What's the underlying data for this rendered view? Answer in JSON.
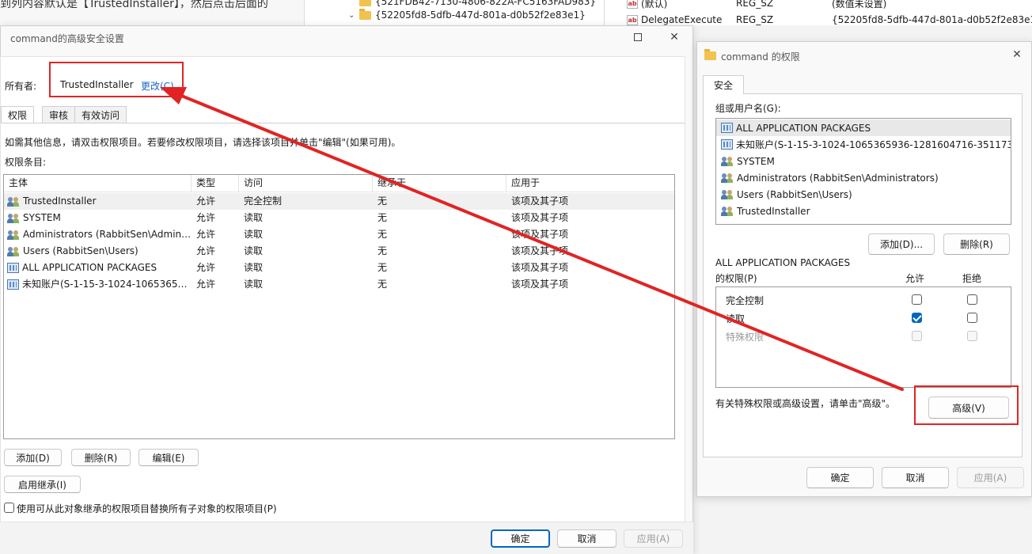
{
  "background": {
    "doc_text": "到列内容默认是【TrustedInstaller】，然后点击后面的",
    "tree_items": [
      "{521FDB42-7130-4806-822A-FC5163FAD983}",
      "{52205fd8-5dfb-447d-801a-d0b52f2e83e1}"
    ],
    "registry_rows": [
      {
        "name": "(默认)",
        "type": "REG_SZ",
        "data": "(数值未设置)"
      },
      {
        "name": "DelegateExecute",
        "type": "REG_SZ",
        "data": "{52205fd8-5dfb-447d-801a-d0b52f2e83e1}"
      }
    ]
  },
  "left_dialog": {
    "title": "command的高级安全设置",
    "owner_label": "所有者:",
    "owner_value": "TrustedInstaller",
    "change_link": "更改(C)",
    "tabs": [
      "权限",
      "审核",
      "有效访问"
    ],
    "info_text": "如需其他信息，请双击权限项目。若要修改权限项目，请选择该项目并单击\"编辑\"(如果可用)。",
    "entries_label": "权限条目:",
    "columns": [
      "主体",
      "类型",
      "访问",
      "继承于",
      "应用于"
    ],
    "rows": [
      {
        "principal": "TrustedInstaller",
        "type": "允许",
        "access": "完全控制",
        "inherited": "无",
        "applies": "该项及其子项",
        "icon": "users-icon"
      },
      {
        "principal": "SYSTEM",
        "type": "允许",
        "access": "读取",
        "inherited": "无",
        "applies": "该项及其子项",
        "icon": "users-icon"
      },
      {
        "principal": "Administrators (RabbitSen\\Adminis...",
        "type": "允许",
        "access": "读取",
        "inherited": "无",
        "applies": "该项及其子项",
        "icon": "users-icon"
      },
      {
        "principal": "Users (RabbitSen\\Users)",
        "type": "允许",
        "access": "读取",
        "inherited": "无",
        "applies": "该项及其子项",
        "icon": "users-icon"
      },
      {
        "principal": "ALL APPLICATION PACKAGES",
        "type": "允许",
        "access": "读取",
        "inherited": "无",
        "applies": "该项及其子项",
        "icon": "package-icon"
      },
      {
        "principal": "未知账户(S-1-15-3-1024-106536593...",
        "type": "允许",
        "access": "读取",
        "inherited": "无",
        "applies": "该项及其子项",
        "icon": "package-icon"
      }
    ],
    "add_btn": "添加(D)",
    "remove_btn": "删除(R)",
    "edit_btn": "编辑(E)",
    "enable_inherit_btn": "启用继承(I)",
    "replace_checkbox_label": "使用可从此对象继承的权限项目替换所有子对象的权限项目(P)",
    "ok_btn": "确定",
    "cancel_btn": "取消",
    "apply_btn": "应用(A)"
  },
  "right_dialog": {
    "title": "command 的权限",
    "tab": "安全",
    "group_label": "组或用户名(G):",
    "groups": [
      {
        "name": "ALL APPLICATION PACKAGES",
        "icon": "package-icon"
      },
      {
        "name": "未知账户(S-1-15-3-1024-1065365936-1281604716-351173...",
        "icon": "package-icon"
      },
      {
        "name": "SYSTEM",
        "icon": "users-icon"
      },
      {
        "name": "Administrators (RabbitSen\\Administrators)",
        "icon": "users-icon"
      },
      {
        "name": "Users (RabbitSen\\Users)",
        "icon": "users-icon"
      },
      {
        "name": "TrustedInstaller",
        "icon": "users-icon"
      }
    ],
    "add_btn": "添加(D)...",
    "remove_btn": "删除(R)",
    "perm_for": "ALL APPLICATION PACKAGES",
    "perm_label": "的权限(P)",
    "allow_header": "允许",
    "deny_header": "拒绝",
    "permissions": [
      {
        "name": "完全控制",
        "allow": false,
        "deny": false,
        "enabled": true
      },
      {
        "name": "读取",
        "allow": true,
        "deny": false,
        "enabled": true
      },
      {
        "name": "特殊权限",
        "allow": false,
        "deny": false,
        "enabled": false
      }
    ],
    "advanced_text": "有关特殊权限或高级设置，请单击\"高级\"。",
    "advanced_btn": "高级(V)",
    "ok_btn": "确定",
    "cancel_btn": "取消",
    "apply_btn": "应用(A)"
  },
  "annotation": {
    "color": "#e02424"
  }
}
